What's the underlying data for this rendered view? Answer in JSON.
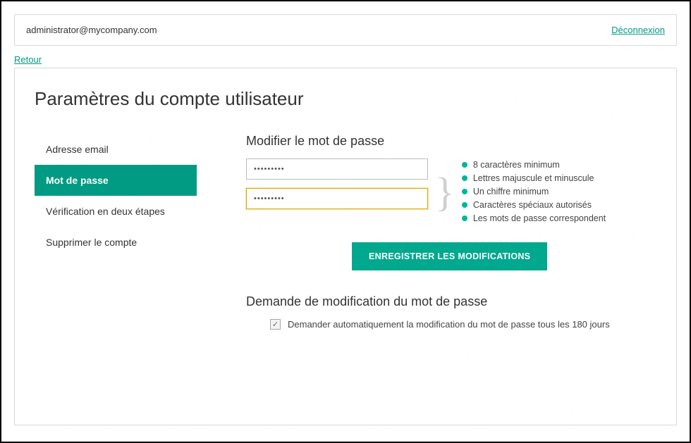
{
  "header": {
    "user_email": "administrator@mycompany.com",
    "logout_label": "Déconnexion"
  },
  "back_label": "Retour",
  "page_title": "Paramètres du compte utilisateur",
  "side_nav": {
    "items": [
      {
        "label": "Adresse email"
      },
      {
        "label": "Mot de passe"
      },
      {
        "label": "Vérification en deux étapes"
      },
      {
        "label": "Supprimer le compte"
      }
    ],
    "active_index": 1
  },
  "password_section": {
    "heading": "Modifier le mot de passe",
    "field1_value": "•••••••••",
    "field2_value": "•••••••••",
    "rules": [
      "8 caractères minimum",
      "Lettres majuscule et minuscule",
      "Un chiffre minimum",
      "Caractères spéciaux autorisés",
      "Les mots de passe correspondent"
    ],
    "save_button_label": "ENREGISTRER LES MODIFICATIONS"
  },
  "request_section": {
    "heading": "Demande de modification du mot de passe",
    "checkbox_checked": true,
    "checkbox_label": "Demander automatiquement la modification du mot de passe tous les 180 jours"
  }
}
